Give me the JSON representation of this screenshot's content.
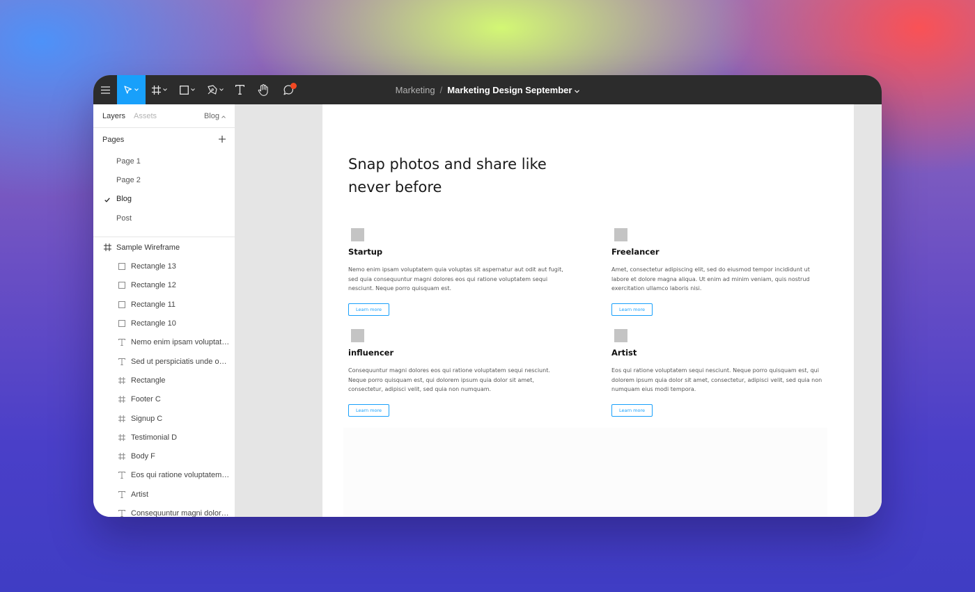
{
  "app": {
    "accent_color": "#18a0fb",
    "notification_color": "#f24822"
  },
  "toolbar": {
    "tools": [
      {
        "name": "menu",
        "icon": "hamburger-icon"
      },
      {
        "name": "move",
        "icon": "cursor-icon",
        "active": true
      },
      {
        "name": "frame",
        "icon": "frame-icon"
      },
      {
        "name": "shape",
        "icon": "rectangle-icon"
      },
      {
        "name": "pen",
        "icon": "pen-icon"
      },
      {
        "name": "text",
        "icon": "text-icon"
      },
      {
        "name": "hand",
        "icon": "hand-icon"
      },
      {
        "name": "comment",
        "icon": "comment-icon"
      }
    ],
    "breadcrumb": {
      "project": "Marketing",
      "separator": "/",
      "file": "Marketing Design September"
    }
  },
  "sidebar": {
    "tabs": {
      "layers": "Layers",
      "assets": "Assets"
    },
    "current_page_select": "Blog",
    "pages_title": "Pages",
    "pages": [
      {
        "label": "Page 1",
        "selected": false
      },
      {
        "label": "Page 2",
        "selected": false
      },
      {
        "label": "Blog",
        "selected": true
      },
      {
        "label": "Post",
        "selected": false
      }
    ],
    "layers": [
      {
        "label": "Sample Wireframe",
        "type": "frame",
        "level": 0
      },
      {
        "label": "Rectangle 13",
        "type": "rectangle",
        "level": 1
      },
      {
        "label": "Rectangle 12",
        "type": "rectangle",
        "level": 1
      },
      {
        "label": "Rectangle 11",
        "type": "rectangle",
        "level": 1
      },
      {
        "label": "Rectangle 10",
        "type": "rectangle",
        "level": 1
      },
      {
        "label": "Nemo enim ipsam voluptatem...",
        "type": "text",
        "level": 1
      },
      {
        "label": "Sed ut perspiciatis unde omnis",
        "type": "text",
        "level": 1
      },
      {
        "label": "Rectangle",
        "type": "frame",
        "level": 1
      },
      {
        "label": "Footer C",
        "type": "frame",
        "level": 1
      },
      {
        "label": "Signup C",
        "type": "frame",
        "level": 1
      },
      {
        "label": "Testimonial D",
        "type": "frame",
        "level": 1
      },
      {
        "label": "Body F",
        "type": "frame",
        "level": 1
      },
      {
        "label": "Eos qui ratione voluptatem se...",
        "type": "text",
        "level": 1
      },
      {
        "label": "Artist",
        "type": "text",
        "level": 1
      },
      {
        "label": "Consequuntur magni dolores ...",
        "type": "text",
        "level": 1
      }
    ]
  },
  "canvas": {
    "hero_title": "Snap photos and share like never before",
    "cards": [
      {
        "title": "Startup",
        "text": "Nemo enim ipsam voluptatem quia voluptas sit aspernatur aut odit aut fugit, sed quia consequuntur magni dolores eos qui ratione voluptatem sequi nesciunt. Neque porro quisquam est.",
        "button": "Learn more"
      },
      {
        "title": "Freelancer",
        "text": "Amet, consectetur adipiscing elit, sed do eiusmod tempor incididunt ut labore et dolore magna aliqua. Ut enim ad minim veniam, quis nostrud exercitation ullamco laboris nisi.",
        "button": "Learn more"
      },
      {
        "title": "influencer",
        "text": "Consequuntur magni dolores eos qui ratione voluptatem sequi nesciunt. Neque porro quisquam est, qui dolorem ipsum quia dolor sit amet, consectetur, adipisci velit, sed quia non numquam.",
        "button": "Learn more"
      },
      {
        "title": "Artist",
        "text": "Eos qui ratione voluptatem sequi nesciunt. Neque porro quisquam est, qui dolorem ipsum quia dolor sit amet, consectetur, adipisci velit, sed quia non numquam eius modi tempora.",
        "button": "Learn more"
      }
    ]
  }
}
